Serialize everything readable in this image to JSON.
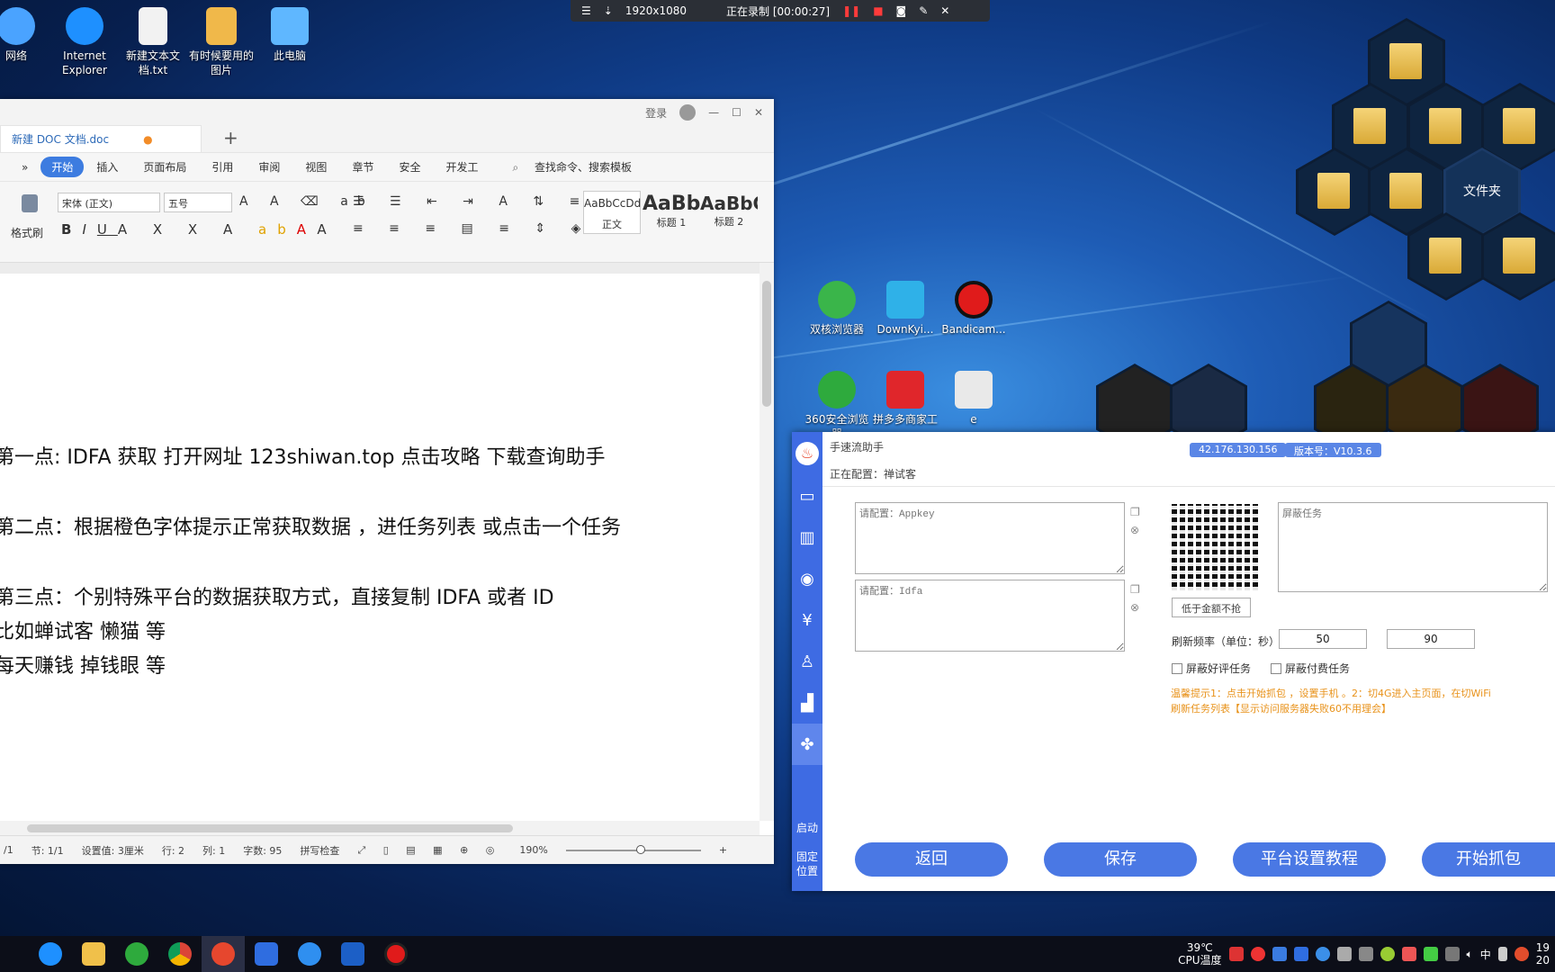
{
  "recorder": {
    "resolution": "1920x1080",
    "status": "正在录制 [00:00:27]"
  },
  "desktop_icons": [
    {
      "label": "网络",
      "color": "#4aa3ff"
    },
    {
      "label": "Internet Explorer",
      "color": "#1e90ff"
    },
    {
      "label": "新建文本文档.txt",
      "color": "#f2f2f2"
    },
    {
      "label": "有时候要用的图片",
      "color": "#f0b84a"
    },
    {
      "label": "此电脑",
      "color": "#5fb7ff"
    },
    {
      "label": "双核浏览器",
      "color": "#3ab54a"
    },
    {
      "label": "DownKyi...",
      "color": "#2fb1e8"
    },
    {
      "label": "Bandicam...",
      "color": "#e01b1b"
    },
    {
      "label": "360安全浏览器",
      "color": "#2eaa3d"
    },
    {
      "label": "拼多多商家工",
      "color": "#e0262b"
    },
    {
      "label": "e",
      "color": "#e9e9e9"
    }
  ],
  "hex_folder_label": "文件夹",
  "word": {
    "login": "登录",
    "doc_tab": "新建 DOC 文档.doc",
    "menu": [
      "开始",
      "插入",
      "页面布局",
      "引用",
      "审阅",
      "视图",
      "章节",
      "安全",
      "开发工"
    ],
    "search": "查找命令、搜索模板",
    "font_name": "宋体 (正文)",
    "font_size": "五号",
    "format_painter": "格式刷",
    "styles": [
      {
        "preview": "AaBbCcDd",
        "name": "正文"
      },
      {
        "preview": "AaBb",
        "name": "标题 1"
      },
      {
        "preview": "AaBbC",
        "name": "标题 2"
      }
    ],
    "lines": [
      "第一点:   IDFA 获取  打开网址 123shiwan.top 点击攻略  下载查询助手",
      "第二点：根据橙色字体提示正常获取数据 ，进任务列表  或点击一个任务",
      "第三点：个别特殊平台的数据获取方式，直接复制 IDFA 或者 ID",
      "比如蝉试客  懒猫  等",
      "每天赚钱  掉钱眼  等"
    ],
    "status": {
      "page": "/1",
      "section": "节: 1/1",
      "setting": "设置值: 3厘米",
      "row": "行: 2",
      "col": "列: 1",
      "words": "字数: 95",
      "spell": "拼写检查",
      "zoom": "190%"
    }
  },
  "helper": {
    "title": "手速流助手",
    "ip": "42.176.130.156",
    "version": "版本号：V10.3.6",
    "configuring": "正在配置：禅试客",
    "appkey_placeholder": "请配置：Appkey",
    "idfa_placeholder": "请配置：Idfa",
    "block_tasks_placeholder": "屏蔽任务",
    "low_amount_btn": "低于金额不抢",
    "refresh_label": "刷新频率（单位：秒）",
    "refresh_min": "50",
    "refresh_max": "90",
    "block_good_review": "屏蔽好评任务",
    "block_paid": "屏蔽付费任务",
    "tip_line1": "温馨提示1：点击开始抓包 ，设置手机 。2：切4G进入主页面，在切WiFi",
    "tip_line2": "刷新任务列表【显示访问服务器失败60不用理会】",
    "side_start": "启动",
    "side_fix1": "固定",
    "side_fix2": "位置",
    "buttons": [
      "返回",
      "保存",
      "平台设置教程",
      "开始抓包"
    ]
  },
  "tray": {
    "temp": "39℃",
    "temp_label": "CPU温度",
    "ime": "中",
    "time": "19",
    "date": "20"
  }
}
